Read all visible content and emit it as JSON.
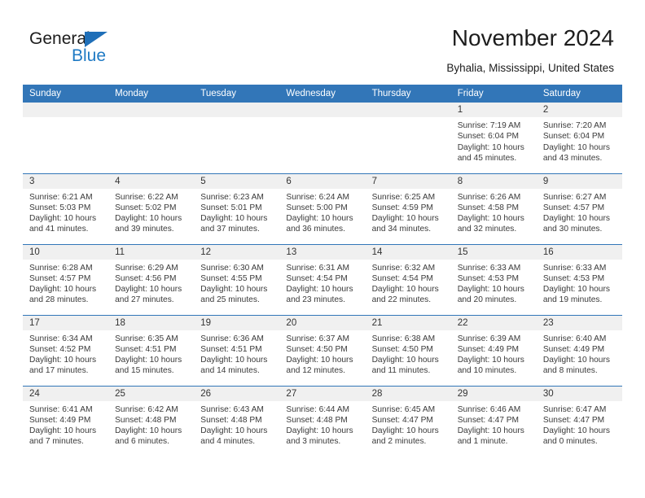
{
  "brand": {
    "name_part1": "General",
    "name_part2": "Blue",
    "triangle_color": "#1f6fb8",
    "blue_color": "#1f7ac4"
  },
  "header": {
    "title": "November 2024",
    "subtitle": "Byhalia, Mississippi, United States"
  },
  "theme": {
    "header_blue": "#3276b8",
    "daynum_band": "#f0f0f0",
    "text": "#3a3a3a"
  },
  "weekday_headers": [
    "Sunday",
    "Monday",
    "Tuesday",
    "Wednesday",
    "Thursday",
    "Friday",
    "Saturday"
  ],
  "weeks": [
    [
      {
        "day": "",
        "empty": true,
        "sunrise": "",
        "sunset": "",
        "daylight_line1": "",
        "daylight_line2": ""
      },
      {
        "day": "",
        "empty": true,
        "sunrise": "",
        "sunset": "",
        "daylight_line1": "",
        "daylight_line2": ""
      },
      {
        "day": "",
        "empty": true,
        "sunrise": "",
        "sunset": "",
        "daylight_line1": "",
        "daylight_line2": ""
      },
      {
        "day": "",
        "empty": true,
        "sunrise": "",
        "sunset": "",
        "daylight_line1": "",
        "daylight_line2": ""
      },
      {
        "day": "",
        "empty": true,
        "sunrise": "",
        "sunset": "",
        "daylight_line1": "",
        "daylight_line2": ""
      },
      {
        "day": "1",
        "empty": false,
        "sunrise": "Sunrise: 7:19 AM",
        "sunset": "Sunset: 6:04 PM",
        "daylight_line1": "Daylight: 10 hours",
        "daylight_line2": "and 45 minutes."
      },
      {
        "day": "2",
        "empty": false,
        "sunrise": "Sunrise: 7:20 AM",
        "sunset": "Sunset: 6:04 PM",
        "daylight_line1": "Daylight: 10 hours",
        "daylight_line2": "and 43 minutes."
      }
    ],
    [
      {
        "day": "3",
        "empty": false,
        "sunrise": "Sunrise: 6:21 AM",
        "sunset": "Sunset: 5:03 PM",
        "daylight_line1": "Daylight: 10 hours",
        "daylight_line2": "and 41 minutes."
      },
      {
        "day": "4",
        "empty": false,
        "sunrise": "Sunrise: 6:22 AM",
        "sunset": "Sunset: 5:02 PM",
        "daylight_line1": "Daylight: 10 hours",
        "daylight_line2": "and 39 minutes."
      },
      {
        "day": "5",
        "empty": false,
        "sunrise": "Sunrise: 6:23 AM",
        "sunset": "Sunset: 5:01 PM",
        "daylight_line1": "Daylight: 10 hours",
        "daylight_line2": "and 37 minutes."
      },
      {
        "day": "6",
        "empty": false,
        "sunrise": "Sunrise: 6:24 AM",
        "sunset": "Sunset: 5:00 PM",
        "daylight_line1": "Daylight: 10 hours",
        "daylight_line2": "and 36 minutes."
      },
      {
        "day": "7",
        "empty": false,
        "sunrise": "Sunrise: 6:25 AM",
        "sunset": "Sunset: 4:59 PM",
        "daylight_line1": "Daylight: 10 hours",
        "daylight_line2": "and 34 minutes."
      },
      {
        "day": "8",
        "empty": false,
        "sunrise": "Sunrise: 6:26 AM",
        "sunset": "Sunset: 4:58 PM",
        "daylight_line1": "Daylight: 10 hours",
        "daylight_line2": "and 32 minutes."
      },
      {
        "day": "9",
        "empty": false,
        "sunrise": "Sunrise: 6:27 AM",
        "sunset": "Sunset: 4:57 PM",
        "daylight_line1": "Daylight: 10 hours",
        "daylight_line2": "and 30 minutes."
      }
    ],
    [
      {
        "day": "10",
        "empty": false,
        "sunrise": "Sunrise: 6:28 AM",
        "sunset": "Sunset: 4:57 PM",
        "daylight_line1": "Daylight: 10 hours",
        "daylight_line2": "and 28 minutes."
      },
      {
        "day": "11",
        "empty": false,
        "sunrise": "Sunrise: 6:29 AM",
        "sunset": "Sunset: 4:56 PM",
        "daylight_line1": "Daylight: 10 hours",
        "daylight_line2": "and 27 minutes."
      },
      {
        "day": "12",
        "empty": false,
        "sunrise": "Sunrise: 6:30 AM",
        "sunset": "Sunset: 4:55 PM",
        "daylight_line1": "Daylight: 10 hours",
        "daylight_line2": "and 25 minutes."
      },
      {
        "day": "13",
        "empty": false,
        "sunrise": "Sunrise: 6:31 AM",
        "sunset": "Sunset: 4:54 PM",
        "daylight_line1": "Daylight: 10 hours",
        "daylight_line2": "and 23 minutes."
      },
      {
        "day": "14",
        "empty": false,
        "sunrise": "Sunrise: 6:32 AM",
        "sunset": "Sunset: 4:54 PM",
        "daylight_line1": "Daylight: 10 hours",
        "daylight_line2": "and 22 minutes."
      },
      {
        "day": "15",
        "empty": false,
        "sunrise": "Sunrise: 6:33 AM",
        "sunset": "Sunset: 4:53 PM",
        "daylight_line1": "Daylight: 10 hours",
        "daylight_line2": "and 20 minutes."
      },
      {
        "day": "16",
        "empty": false,
        "sunrise": "Sunrise: 6:33 AM",
        "sunset": "Sunset: 4:53 PM",
        "daylight_line1": "Daylight: 10 hours",
        "daylight_line2": "and 19 minutes."
      }
    ],
    [
      {
        "day": "17",
        "empty": false,
        "sunrise": "Sunrise: 6:34 AM",
        "sunset": "Sunset: 4:52 PM",
        "daylight_line1": "Daylight: 10 hours",
        "daylight_line2": "and 17 minutes."
      },
      {
        "day": "18",
        "empty": false,
        "sunrise": "Sunrise: 6:35 AM",
        "sunset": "Sunset: 4:51 PM",
        "daylight_line1": "Daylight: 10 hours",
        "daylight_line2": "and 15 minutes."
      },
      {
        "day": "19",
        "empty": false,
        "sunrise": "Sunrise: 6:36 AM",
        "sunset": "Sunset: 4:51 PM",
        "daylight_line1": "Daylight: 10 hours",
        "daylight_line2": "and 14 minutes."
      },
      {
        "day": "20",
        "empty": false,
        "sunrise": "Sunrise: 6:37 AM",
        "sunset": "Sunset: 4:50 PM",
        "daylight_line1": "Daylight: 10 hours",
        "daylight_line2": "and 12 minutes."
      },
      {
        "day": "21",
        "empty": false,
        "sunrise": "Sunrise: 6:38 AM",
        "sunset": "Sunset: 4:50 PM",
        "daylight_line1": "Daylight: 10 hours",
        "daylight_line2": "and 11 minutes."
      },
      {
        "day": "22",
        "empty": false,
        "sunrise": "Sunrise: 6:39 AM",
        "sunset": "Sunset: 4:49 PM",
        "daylight_line1": "Daylight: 10 hours",
        "daylight_line2": "and 10 minutes."
      },
      {
        "day": "23",
        "empty": false,
        "sunrise": "Sunrise: 6:40 AM",
        "sunset": "Sunset: 4:49 PM",
        "daylight_line1": "Daylight: 10 hours",
        "daylight_line2": "and 8 minutes."
      }
    ],
    [
      {
        "day": "24",
        "empty": false,
        "sunrise": "Sunrise: 6:41 AM",
        "sunset": "Sunset: 4:49 PM",
        "daylight_line1": "Daylight: 10 hours",
        "daylight_line2": "and 7 minutes."
      },
      {
        "day": "25",
        "empty": false,
        "sunrise": "Sunrise: 6:42 AM",
        "sunset": "Sunset: 4:48 PM",
        "daylight_line1": "Daylight: 10 hours",
        "daylight_line2": "and 6 minutes."
      },
      {
        "day": "26",
        "empty": false,
        "sunrise": "Sunrise: 6:43 AM",
        "sunset": "Sunset: 4:48 PM",
        "daylight_line1": "Daylight: 10 hours",
        "daylight_line2": "and 4 minutes."
      },
      {
        "day": "27",
        "empty": false,
        "sunrise": "Sunrise: 6:44 AM",
        "sunset": "Sunset: 4:48 PM",
        "daylight_line1": "Daylight: 10 hours",
        "daylight_line2": "and 3 minutes."
      },
      {
        "day": "28",
        "empty": false,
        "sunrise": "Sunrise: 6:45 AM",
        "sunset": "Sunset: 4:47 PM",
        "daylight_line1": "Daylight: 10 hours",
        "daylight_line2": "and 2 minutes."
      },
      {
        "day": "29",
        "empty": false,
        "sunrise": "Sunrise: 6:46 AM",
        "sunset": "Sunset: 4:47 PM",
        "daylight_line1": "Daylight: 10 hours",
        "daylight_line2": "and 1 minute."
      },
      {
        "day": "30",
        "empty": false,
        "sunrise": "Sunrise: 6:47 AM",
        "sunset": "Sunset: 4:47 PM",
        "daylight_line1": "Daylight: 10 hours",
        "daylight_line2": "and 0 minutes."
      }
    ]
  ]
}
